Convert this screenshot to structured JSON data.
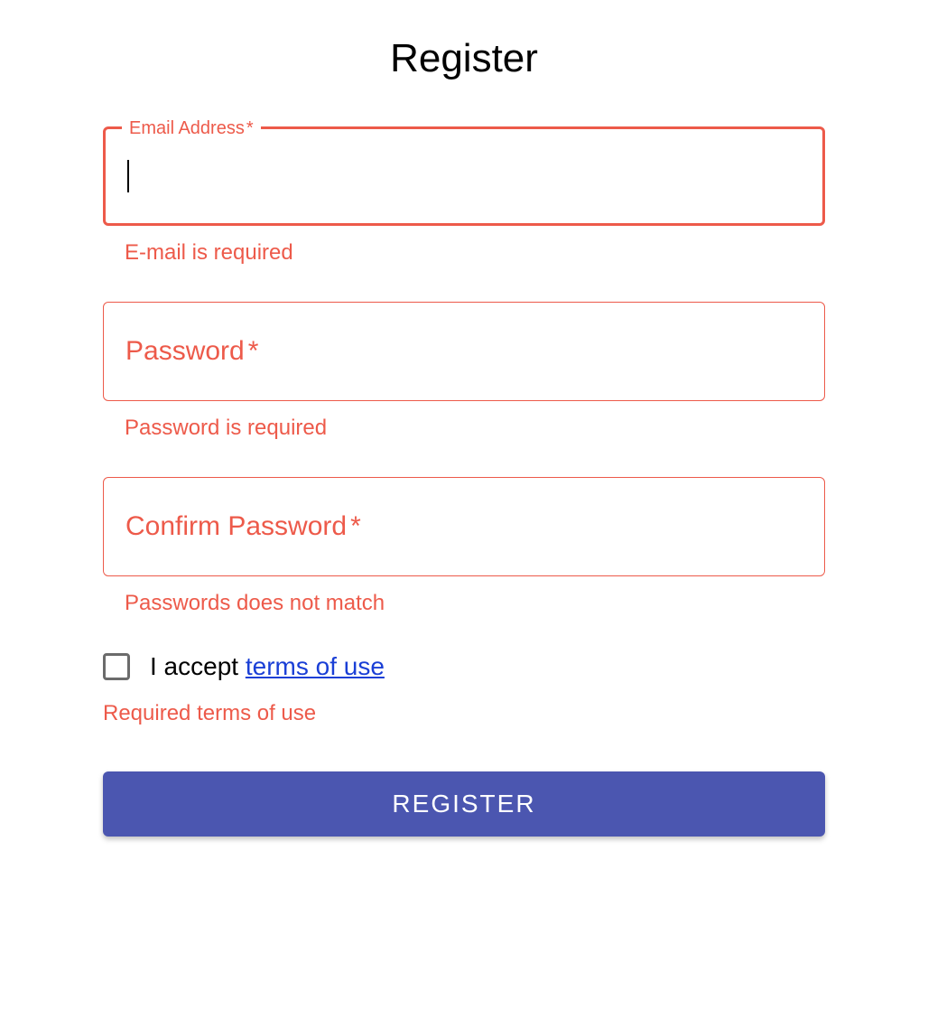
{
  "title": "Register",
  "colors": {
    "error": "#ed5a4a",
    "primary": "#4b56b0",
    "link": "#1a3fd6"
  },
  "fields": {
    "email": {
      "label": "Email Address",
      "required_mark": "*",
      "value": "",
      "error": "E-mail is required"
    },
    "password": {
      "label": "Password",
      "required_mark": "*",
      "value": "",
      "error": "Password is required"
    },
    "confirm_password": {
      "label": "Confirm Password",
      "required_mark": "*",
      "value": "",
      "error": "Passwords does not match"
    }
  },
  "terms": {
    "checked": false,
    "prefix": "I accept ",
    "link_text": "terms of use",
    "error": "Required terms of use"
  },
  "submit": {
    "label": "REGISTER"
  }
}
